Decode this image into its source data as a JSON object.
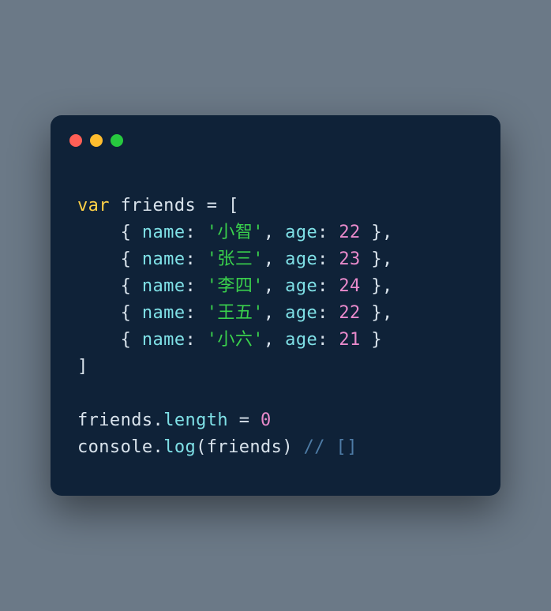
{
  "code": {
    "keyword_var": "var",
    "var_name": "friends",
    "eq": " = ",
    "open_bracket": "[",
    "close_bracket": "]",
    "obj_open": "{ ",
    "obj_close": " }",
    "prop_name": "name",
    "prop_age": "age",
    "colon": ": ",
    "comma": ",",
    "comma_sp": ", ",
    "friends": [
      {
        "name": "'小智'",
        "age": "22"
      },
      {
        "name": "'张三'",
        "age": "23"
      },
      {
        "name": "'李四'",
        "age": "24"
      },
      {
        "name": "'王五'",
        "age": "22"
      },
      {
        "name": "'小六'",
        "age": "21"
      }
    ],
    "stmt2_obj": "friends",
    "stmt2_dot": ".",
    "stmt2_prop": "length",
    "stmt2_eq": " = ",
    "stmt2_val": "0",
    "stmt3_obj": "console",
    "stmt3_dot": ".",
    "stmt3_method": "log",
    "stmt3_open": "(",
    "stmt3_arg": "friends",
    "stmt3_close": ")",
    "stmt3_comment": " // []"
  }
}
